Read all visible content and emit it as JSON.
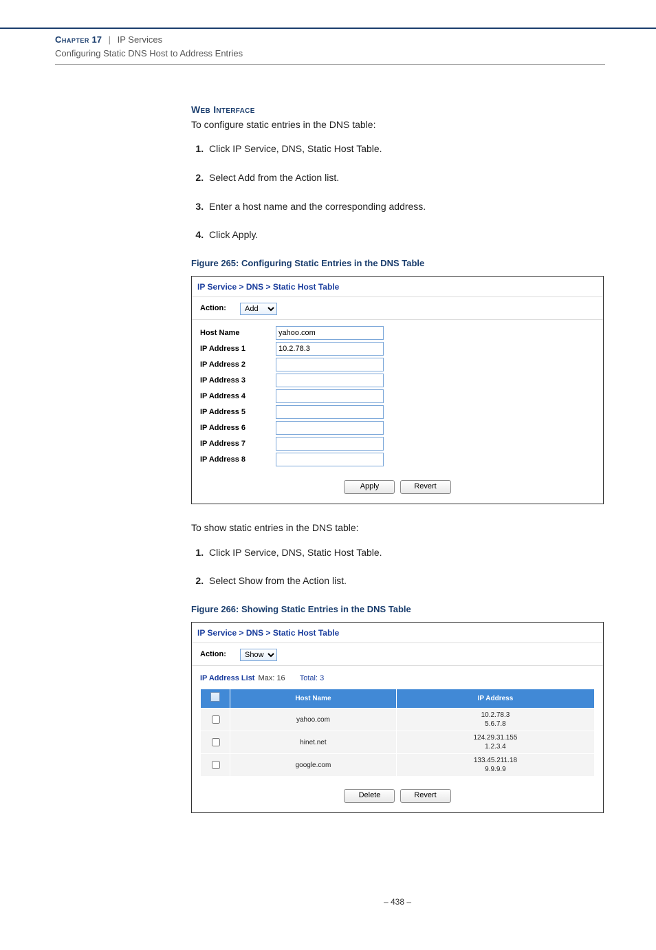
{
  "header": {
    "chapter_label": "Chapter",
    "chapter_number": "17",
    "chapter_title": "IP Services",
    "section": "Configuring Static DNS Host to Address Entries"
  },
  "web_interface_heading": "Web Interface",
  "intro_text": "To configure static entries in the DNS table:",
  "steps_configure": [
    "Click IP Service, DNS, Static Host Table.",
    "Select Add from the Action list.",
    "Enter a host name and the corresponding address.",
    "Click Apply."
  ],
  "figure265_caption": "Figure 265:  Configuring Static Entries in the DNS Table",
  "panel_add": {
    "breadcrumb": "IP Service > DNS > Static Host Table",
    "action_label": "Action:",
    "action_value": "Add",
    "fields": [
      {
        "label": "Host Name",
        "value": "yahoo.com"
      },
      {
        "label": "IP Address 1",
        "value": "10.2.78.3"
      },
      {
        "label": "IP Address 2",
        "value": ""
      },
      {
        "label": "IP Address 3",
        "value": ""
      },
      {
        "label": "IP Address 4",
        "value": ""
      },
      {
        "label": "IP Address 5",
        "value": ""
      },
      {
        "label": "IP Address 6",
        "value": ""
      },
      {
        "label": "IP Address 7",
        "value": ""
      },
      {
        "label": "IP Address 8",
        "value": ""
      }
    ],
    "apply_label": "Apply",
    "revert_label": "Revert"
  },
  "show_intro": "To show static entries in the DNS table:",
  "steps_show": [
    "Click IP Service, DNS, Static Host Table.",
    "Select Show from the Action list."
  ],
  "figure266_caption": "Figure 266:  Showing Static Entries in the DNS Table",
  "panel_show": {
    "breadcrumb": "IP Service > DNS > Static Host Table",
    "action_label": "Action:",
    "action_value": "Show",
    "list_title": "IP Address List",
    "max_label": "Max: 16",
    "total_label": "Total: 3",
    "col_host": "Host Name",
    "col_ip": "IP Address",
    "rows": [
      {
        "host": "yahoo.com",
        "ips": "10.2.78.3\n5.6.7.8"
      },
      {
        "host": "hinet.net",
        "ips": "124.29.31.155\n1.2.3.4"
      },
      {
        "host": "google.com",
        "ips": "133.45.211.18\n9.9.9.9"
      }
    ],
    "delete_label": "Delete",
    "revert_label": "Revert"
  },
  "page_number": "–  438  –"
}
